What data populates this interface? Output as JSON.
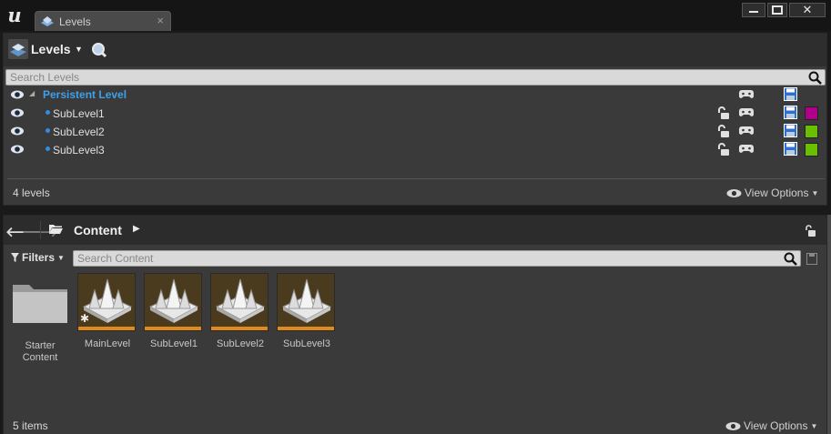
{
  "window": {
    "tab_label": "Levels",
    "tab_close": "×",
    "min_label": "▁",
    "max_label": "▣",
    "close_label": "✕"
  },
  "levels": {
    "title": "Levels",
    "search_placeholder": "Search Levels",
    "rows": [
      {
        "name": "Persistent Level",
        "color": null
      },
      {
        "name": "SubLevel1",
        "color": "#b0008a"
      },
      {
        "name": "SubLevel2",
        "color": "#6ac000"
      },
      {
        "name": "SubLevel3",
        "color": "#6ac000"
      }
    ],
    "count_label": "4 levels",
    "view_options": "View Options"
  },
  "content": {
    "path": "Content",
    "filters_label": "Filters",
    "search_placeholder": "Search Content",
    "assets": [
      {
        "name": "Starter Content",
        "kind": "folder"
      },
      {
        "name": "MainLevel",
        "kind": "level",
        "modified": true
      },
      {
        "name": "SubLevel1",
        "kind": "level"
      },
      {
        "name": "SubLevel2",
        "kind": "level"
      },
      {
        "name": "SubLevel3",
        "kind": "level"
      }
    ],
    "item_count": "5 items",
    "view_options": "View Options"
  },
  "colors": {
    "accent_blue": "#3ea0e8",
    "level_thumb_bar": "#e08a1e"
  }
}
